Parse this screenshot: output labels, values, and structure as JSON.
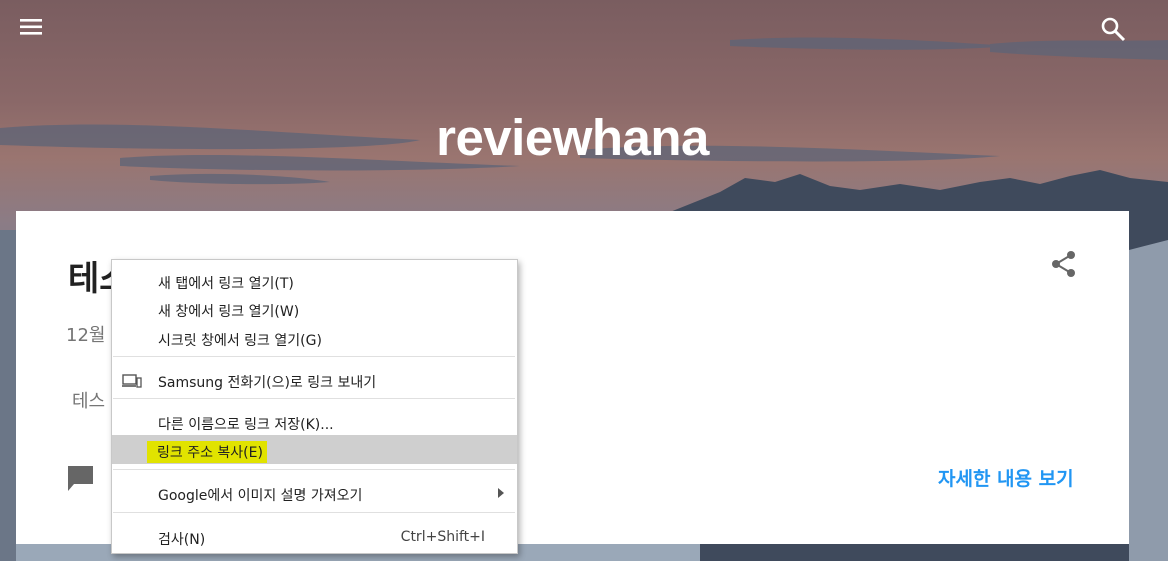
{
  "header": {
    "blog_title": "reviewhana"
  },
  "post": {
    "title": "테스",
    "date": "12월",
    "snippet": "테스",
    "read_more": "자세한 내용 보기"
  },
  "context_menu": {
    "items": [
      {
        "label": "새 탭에서 링크 열기(T)"
      },
      {
        "label": "새 창에서 링크 열기(W)"
      },
      {
        "label": "시크릿 창에서 링크 열기(G)"
      },
      {
        "label": "Samsung 전화기(으)로 링크 보내기"
      },
      {
        "label": "다른 이름으로 링크 저장(K)..."
      },
      {
        "label": "링크 주소 복사(E)"
      },
      {
        "label": "Google에서 이미지 설명 가져오기"
      },
      {
        "label": "검사(N)",
        "shortcut": "Ctrl+Shift+I"
      }
    ],
    "highlighted_index": 5,
    "highlight_color": "#e1e300"
  },
  "colors": {
    "accent": "#2196f3",
    "card": "#ffffff"
  }
}
